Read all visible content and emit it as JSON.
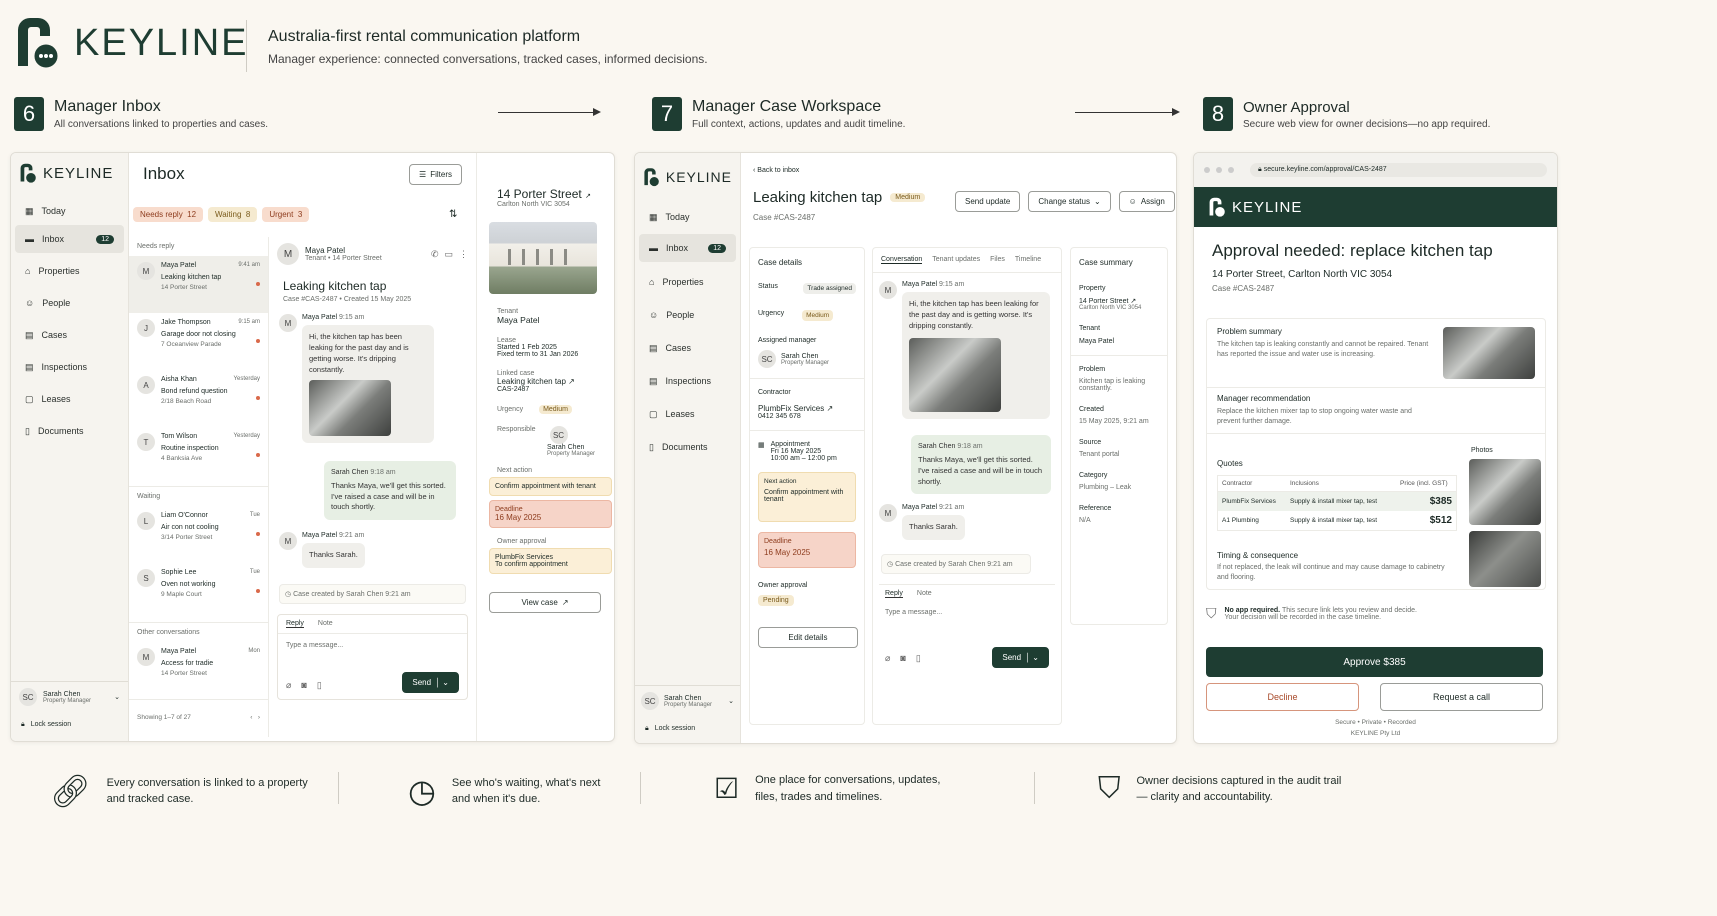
{
  "brand": {
    "name": "KEYLINE",
    "tagline": "Australia-first rental communication platform",
    "subtitle": "Manager experience: connected conversations, tracked cases, informed decisions."
  },
  "steps": [
    {
      "num": "6",
      "title": "Manager Inbox",
      "desc": "All conversations linked to properties and cases."
    },
    {
      "num": "7",
      "title": "Manager Case Workspace",
      "desc": "Full context, actions, updates and audit timeline."
    },
    {
      "num": "8",
      "title": "Owner Approval",
      "desc": "Secure web view for owner decisions—no app required."
    }
  ],
  "nav": [
    "Today",
    "Inbox",
    "Properties",
    "People",
    "Cases",
    "Inspections",
    "Leases",
    "Documents"
  ],
  "inbox_badge": "12",
  "user": {
    "initials": "SC",
    "name": "Sarah Chen",
    "role": "Property Manager",
    "lock": "Lock session"
  },
  "inbox": {
    "title": "Inbox",
    "filters": "Filters",
    "chips": [
      {
        "label": "Needs reply",
        "count": "12"
      },
      {
        "label": "Waiting",
        "count": "8"
      },
      {
        "label": "Urgent",
        "count": "3"
      }
    ],
    "needs_reply": "Needs reply",
    "waiting": "Waiting",
    "other": "Other conversations",
    "list": [
      {
        "i": "M",
        "name": "Maya Patel",
        "time": "9:41 am",
        "subj": "Leaking kitchen tap",
        "addr": "14 Porter Street"
      },
      {
        "i": "J",
        "name": "Jake Thompson",
        "time": "9:15 am",
        "subj": "Garage door not closing",
        "addr": "7 Oceanview Parade"
      },
      {
        "i": "A",
        "name": "Aisha Khan",
        "time": "Yesterday",
        "subj": "Bond refund question",
        "addr": "2/18 Beach Road"
      },
      {
        "i": "T",
        "name": "Tom Wilson",
        "time": "Yesterday",
        "subj": "Routine inspection",
        "addr": "4 Banksia Ave"
      },
      {
        "i": "L",
        "name": "Liam O'Connor",
        "time": "Tue",
        "subj": "Air con not cooling",
        "addr": "3/14 Porter Street"
      },
      {
        "i": "S",
        "name": "Sophie Lee",
        "time": "Tue",
        "subj": "Oven not working",
        "addr": "9 Maple Court"
      },
      {
        "i": "M",
        "name": "Maya Patel",
        "time": "Mon",
        "subj": "Access for tradie",
        "addr": "14 Porter Street"
      }
    ],
    "showing": "Showing 1–7 of 27"
  },
  "convo": {
    "name": "Maya Patel",
    "sub": "Tenant • 14 Porter Street",
    "title": "Leaking kitchen tap",
    "case": "Case #CAS-2487 • Created 15 May 2025",
    "m1_name": "Maya Patel",
    "m1_time": "9:15 am",
    "m1": "Hi, the kitchen tap has been leaking for the past day and is getting worse. It's dripping constantly.",
    "m2_name": "Sarah Chen",
    "m2_time": "9:18 am",
    "m2": "Thanks Maya, we'll get this sorted. I've raised a case and will be in touch shortly.",
    "m3_name": "Maya Patel",
    "m3_time": "9:21 am",
    "m3": "Thanks Sarah.",
    "log": "Case created by Sarah Chen 9:21 am",
    "reply": "Reply",
    "note": "Note",
    "placeholder": "Type a message...",
    "send": "Send"
  },
  "prop": {
    "title": "14 Porter Street",
    "suburb": "Carlton North VIC 3054",
    "tenant_l": "Tenant",
    "tenant": "Maya Patel",
    "lease_l": "Lease",
    "lease1": "Started 1 Feb 2025",
    "lease2": "Fixed term to 31 Jan 2026",
    "linked_l": "Linked case",
    "linked": "Leaking kitchen tap",
    "linked_id": "CAS-2487",
    "urg_l": "Urgency",
    "urg": "Medium",
    "resp_l": "Responsible",
    "resp": "Sarah Chen",
    "resp_role": "Property Manager",
    "next_l": "Next action",
    "next": "Confirm appointment with tenant",
    "dead_l": "Deadline",
    "dead": "16 May 2025",
    "own_l": "Owner approval",
    "own": "PlumbFix Services",
    "own2": "To confirm appointment",
    "view": "View case"
  },
  "ws": {
    "back": "Back to inbox",
    "title": "Leaking kitchen tap",
    "urg": "Medium",
    "case": "Case #CAS-2487",
    "b1": "Send update",
    "b2": "Change status",
    "b3": "Assign",
    "details": "Case details",
    "status_l": "Status",
    "status": "Trade assigned",
    "urg_l": "Urgency",
    "mgr_l": "Assigned manager",
    "con_l": "Contractor",
    "con": "PlumbFix Services",
    "con_ph": "0412 345 678",
    "appt_l": "Appointment",
    "appt1": "Fri 16 May 2025",
    "appt2": "10:00 am – 12:00 pm",
    "next_l": "Next action",
    "next": "Confirm appointment with tenant",
    "dead_l": "Deadline",
    "dead": "16 May 2025",
    "own_l": "Owner approval",
    "own": "Pending",
    "edit": "Edit details",
    "tabs": [
      "Conversation",
      "Tenant updates",
      "Files",
      "Timeline"
    ],
    "sum": "Case summary",
    "prop_l": "Property",
    "prop": "14 Porter Street",
    "prop2": "Carlton North VIC 3054",
    "ten_l": "Tenant",
    "ten": "Maya Patel",
    "prob_l": "Problem",
    "prob": "Kitchen tap is leaking constantly.",
    "cre_l": "Created",
    "cre": "15 May 2025, 9:21 am",
    "src_l": "Source",
    "src": "Tenant portal",
    "cat_l": "Category",
    "cat": "Plumbing – Leak",
    "ref_l": "Reference",
    "ref": "N/A"
  },
  "owner": {
    "url": "secure.keyline.com/approval/CAS-2487",
    "title": "Approval needed: replace kitchen tap",
    "addr": "14 Porter Street, Carlton North VIC 3054",
    "case": "Case #CAS-2487",
    "ps_l": "Problem summary",
    "ps": "The kitchen tap is leaking constantly and cannot be repaired. Tenant has reported the issue and water use is increasing.",
    "mr_l": "Manager recommendation",
    "mr": "Replace the kitchen mixer tap to stop ongoing water waste and prevent further damage.",
    "q_l": "Quotes",
    "photos": "Photos",
    "q_head": [
      "Contractor",
      "Inclusions",
      "Price (incl. GST)"
    ],
    "quotes": [
      {
        "c": "PlumbFix Services",
        "i": "Supply & install mixer tap, test",
        "p": "$385"
      },
      {
        "c": "A1 Plumbing",
        "i": "Supply & install mixer tap, test",
        "p": "$512"
      }
    ],
    "tc_l": "Timing & consequence",
    "tc": "If not replaced, the leak will continue and may cause damage to cabinetry and flooring.",
    "noapp": "No app required.",
    "noapp2": "This secure link lets you review and decide.",
    "noapp3": "Your decision will be recorded in the case timeline.",
    "approve": "Approve $385",
    "decline": "Decline",
    "call": "Request a call",
    "foot": "Secure • Private • Recorded",
    "foot2": "KEYLINE Pty Ltd"
  },
  "features": [
    {
      "t1": "Every conversation is linked to a property",
      "t2": "and tracked case."
    },
    {
      "t1": "See who's waiting, what's next",
      "t2": "and when it's due."
    },
    {
      "t1": "One place for conversations, updates,",
      "t2": "files, trades and timelines."
    },
    {
      "t1": "Owner decisions captured in the audit trail",
      "t2": "— clarity and accountability."
    }
  ],
  "colors": {
    "brand": "#1e3d32",
    "urgent": "#f8dccd",
    "medium": "#f5ead0",
    "bg": "#faf7f1"
  }
}
